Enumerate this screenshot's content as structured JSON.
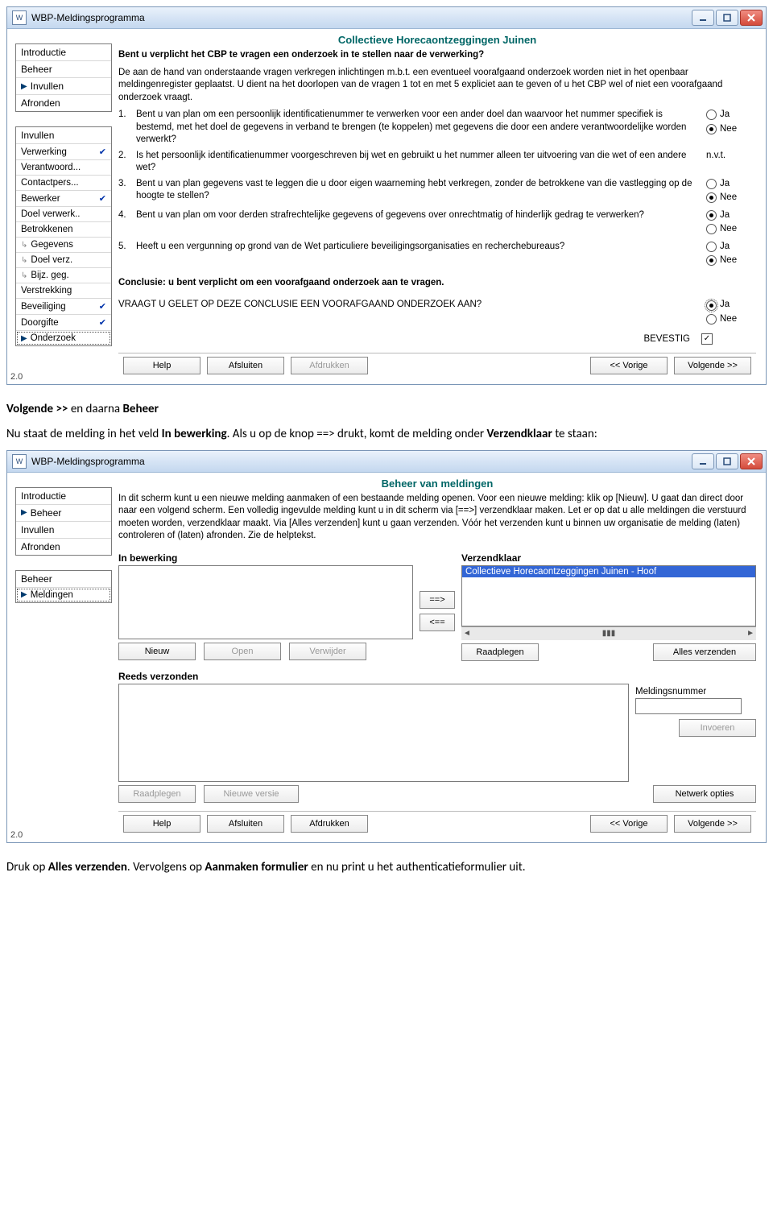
{
  "app_title": "WBP-Meldingsprogramma",
  "version": "2.0",
  "win_controls": {
    "min": "minimize-icon",
    "max": "maximize-icon",
    "close": "close-icon"
  },
  "nav_main": {
    "items": [
      {
        "label": "Introductie",
        "active": false
      },
      {
        "label": "Beheer",
        "active": false
      },
      {
        "label": "Invullen",
        "active": true
      },
      {
        "label": "Afronden",
        "active": false
      }
    ]
  },
  "nav_sub_header": "Invullen",
  "nav_sub_items": [
    {
      "label": "Verwerking",
      "mark": "✔"
    },
    {
      "label": "Verantwoord...",
      "mark": ""
    },
    {
      "label": "Contactpers...",
      "mark": ""
    },
    {
      "label": "Bewerker",
      "mark": "✔"
    },
    {
      "label": "Doel verwerk..",
      "mark": ""
    },
    {
      "label": "Betrokkenen",
      "mark": ""
    },
    {
      "label": "Gegevens",
      "mark": "",
      "indent": true
    },
    {
      "label": "Doel verz.",
      "mark": "",
      "indent": true
    },
    {
      "label": "Bijz. geg.",
      "mark": "",
      "indent": true
    },
    {
      "label": "Verstrekking",
      "mark": ""
    },
    {
      "label": "Beveiliging",
      "mark": "✔"
    },
    {
      "label": "Doorgifte",
      "mark": "✔"
    },
    {
      "label": "Onderzoek",
      "mark": "",
      "active": true
    }
  ],
  "page1": {
    "header": "Collectieve Horecaontzeggingen Juinen",
    "question_title": "Bent u verplicht het CBP te vragen een onderzoek in te stellen naar de verwerking?",
    "intro": "De aan de hand van onderstaande vragen verkregen inlichtingen m.b.t. een eventueel voorafgaand onderzoek worden niet in het openbaar meldingenregister geplaatst. U dient na het doorlopen van de vragen 1 tot en met 5 expliciet aan te geven of u het CBP wel of niet een voorafgaand onderzoek vraagt.",
    "questions": [
      {
        "num": "1.",
        "text": "Bent u van plan om een persoonlijk identificatienummer te verwerken voor een ander doel dan waarvoor het nummer specifiek is bestemd, met het doel de gegevens in verband te brengen (te koppelen) met gegevens die door een andere verantwoordelijke worden verwerkt?",
        "answers": [
          "Ja",
          "Nee"
        ],
        "selected": "Nee"
      },
      {
        "num": "2.",
        "text": "Is het persoonlijk identificatienummer voorgeschreven bij wet en gebruikt u het nummer alleen ter uitvoering van die wet of een andere wet?",
        "nvt": "n.v.t."
      },
      {
        "num": "3.",
        "text": "Bent u van plan gegevens vast te leggen die u door eigen waarneming hebt verkregen, zonder de betrokkene van die vastlegging op de hoogte te stellen?",
        "answers": [
          "Ja",
          "Nee"
        ],
        "selected": "Nee"
      },
      {
        "num": "4.",
        "text": "Bent u van plan om voor derden strafrechtelijke gegevens of gegevens over onrechtmatig of hinderlijk gedrag te verwerken?",
        "answers": [
          "Ja",
          "Nee"
        ],
        "selected": "Ja"
      },
      {
        "num": "5.",
        "text": "Heeft u een vergunning op grond van de Wet particuliere beveiligingsorganisaties en recherchebureaus?",
        "answers": [
          "Ja",
          "Nee"
        ],
        "selected": "Nee"
      }
    ],
    "conclusion": "Conclusie: u bent verplicht om een voorafgaand onderzoek aan te vragen.",
    "final_prompt": "VRAAGT U GELET OP DEZE CONCLUSIE EEN VOORAFGAAND ONDERZOEK AAN?",
    "final_answers": [
      "Ja",
      "Nee"
    ],
    "final_selected": "Ja",
    "confirm_label": "BEVESTIG",
    "confirm_checked": true,
    "buttons": {
      "help": "Help",
      "afsluiten": "Afsluiten",
      "afdrukken": "Afdrukken",
      "prev": "<< Vorige",
      "next": "Volgende >>"
    }
  },
  "instr1_pre": "Volgende >> ",
  "instr1_mid": "en daarna ",
  "instr1_b1": "Beheer",
  "instr2_a": "Nu staat de melding in het veld ",
  "instr2_b": "In bewerking",
  "instr2_c": ". Als u op de knop ==> drukt, komt de melding onder ",
  "instr2_d": "Verzendklaar",
  "instr2_e": " te staan:",
  "nav_main2": {
    "items": [
      {
        "label": "Introductie",
        "active": false
      },
      {
        "label": "Beheer",
        "active": true
      },
      {
        "label": "Invullen",
        "active": false
      },
      {
        "label": "Afronden",
        "active": false
      }
    ]
  },
  "nav_sub2_header": "Beheer",
  "nav_sub2_items": [
    {
      "label": "Meldingen",
      "active": true
    }
  ],
  "page2": {
    "header": "Beheer van meldingen",
    "intro": "In dit scherm kunt u een nieuwe melding aanmaken of een bestaande melding openen. Voor een nieuwe melding: klik op [Nieuw]. U gaat dan direct door naar een volgend scherm. Een volledig ingevulde melding kunt u in dit scherm via [==>] verzendklaar maken. Let er op dat u alle meldingen die verstuurd moeten worden, verzendklaar maakt. Via [Alles verzenden] kunt u gaan verzenden. Vóór het verzenden kunt u binnen uw organisatie de melding (laten) controleren of (laten) afronden. Zie de helptekst.",
    "labels": {
      "in_bewerking": "In bewerking",
      "verzendklaar": "Verzendklaar",
      "reeds_verzonden": "Reeds verzonden",
      "meldingsnummer": "Meldingsnummer"
    },
    "verzendklaar_items": [
      "Collectieve Horecaontzeggingen Juinen - Hoof"
    ],
    "midbtns": {
      "right": "==>",
      "left": "<=="
    },
    "buttons": {
      "nieuw": "Nieuw",
      "open": "Open",
      "verwijder": "Verwijder",
      "raadplegen": "Raadplegen",
      "alles_verzenden": "Alles verzenden",
      "raadplegen2": "Raadplegen",
      "nieuwe_versie": "Nieuwe versie",
      "invoeren": "Invoeren",
      "netwerk": "Netwerk opties",
      "help": "Help",
      "afsluiten": "Afsluiten",
      "afdrukken": "Afdrukken",
      "prev": "<< Vorige",
      "next": "Volgende >>"
    }
  },
  "instr3_a": "Druk op ",
  "instr3_b": "Alles verzenden",
  "instr3_c": ". Vervolgens op ",
  "instr3_d": "Aanmaken formulier",
  "instr3_e": " en nu print u het authenticatieformulier uit."
}
